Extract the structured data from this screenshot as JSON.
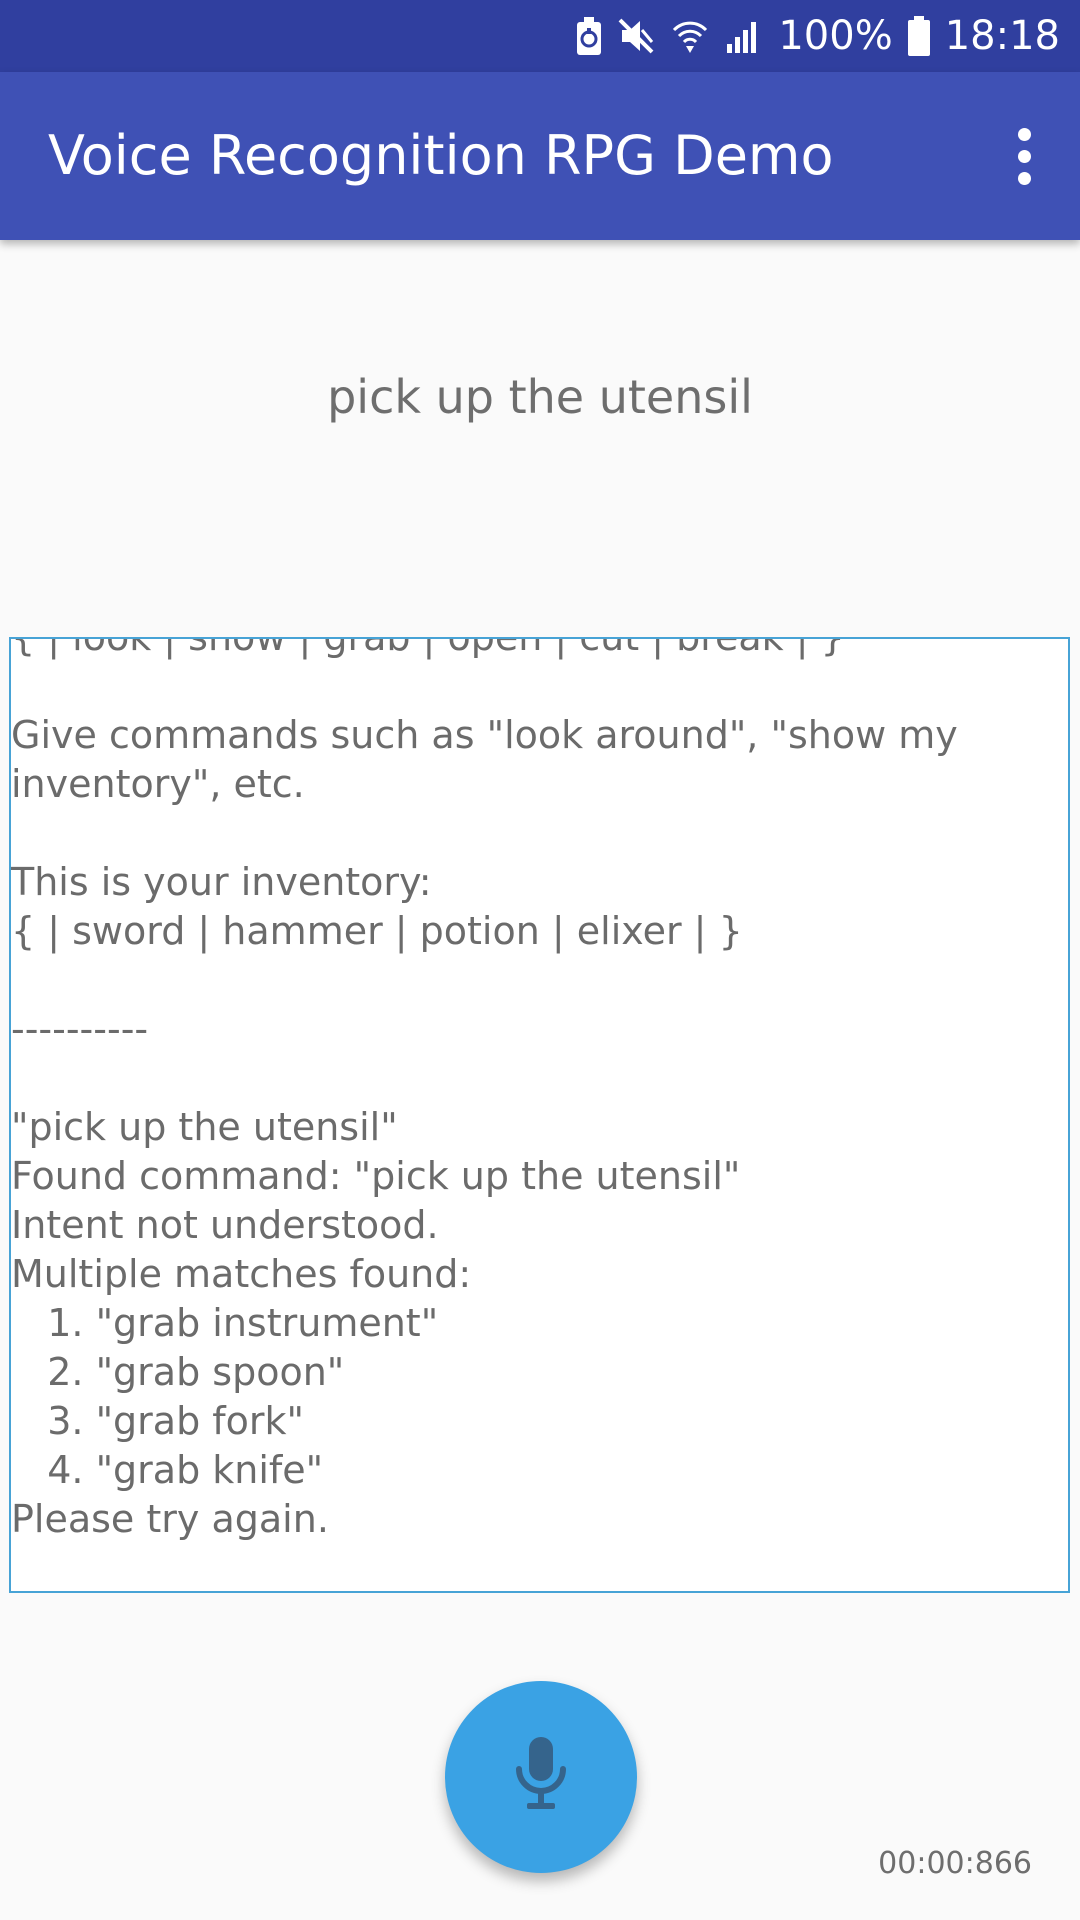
{
  "status_bar": {
    "battery_percent": "100%",
    "time": "18:18",
    "icons": [
      "battery-saver-icon",
      "mute-icon",
      "wifi-icon",
      "signal-icon",
      "battery-icon"
    ]
  },
  "app_bar": {
    "title": "Voice Recognition RPG Demo",
    "menu_icon": "overflow-menu-icon"
  },
  "recognized_phrase": "pick up the utensil",
  "log": {
    "text": "{ | look | show | grab | open | cut | break | }\n\nGive commands such as \"look around\", \"show my\ninventory\", etc.\n\nThis is your inventory:\n{ | sword | hammer | potion | elixer | }\n\n----------\n\n\"pick up the utensil\"\nFound command: \"pick up the utensil\"\nIntent not understood.\nMultiple matches found:\n   1. \"grab instrument\"\n   2. \"grab spoon\"\n   3. \"grab fork\"\n   4. \"grab knife\"\nPlease try again."
  },
  "mic_button": {
    "icon": "microphone-icon"
  },
  "timer": "00:00:866",
  "colors": {
    "status_bar": "#303f9f",
    "app_bar": "#3f51b5",
    "fab": "#3aa2e4",
    "log_border": "#47a3d6",
    "background": "#fafafa"
  }
}
